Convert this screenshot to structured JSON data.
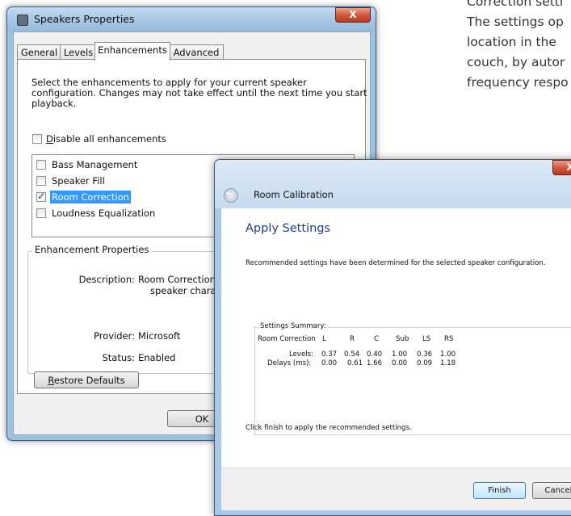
{
  "background_text": [
    "Correction setti",
    "The settings op",
    "location in the",
    "couch, by autor",
    "frequency respo"
  ],
  "speakers_window": {
    "title": "Speakers Properties",
    "close_label": "X",
    "tabs": [
      "General",
      "Levels",
      "Enhancements",
      "Advanced"
    ],
    "active_tab": "Enhancements",
    "description_lines": [
      "Select the enhancements to apply for your current speaker",
      "configuration. Changes may not take effect until the next time you start",
      "playback."
    ],
    "disable_all": {
      "prefix": "",
      "underlined": "D",
      "rest": "isable all enhancements",
      "checked": false
    },
    "enhancements": [
      {
        "label": "Bass Management",
        "checked": false,
        "selected": false
      },
      {
        "label": "Speaker Fill",
        "checked": false,
        "selected": false
      },
      {
        "label": "Room Correction",
        "checked": true,
        "selected": true
      },
      {
        "label": "Loudness Equalization",
        "checked": false,
        "selected": false
      }
    ],
    "properties_group_label": "Enhancement Properties",
    "description_key": "Description:",
    "description_value_line1": "Room Correction co",
    "description_value_line2": "speaker characteris",
    "provider_key": "Provider:",
    "provider_value": "Microsoft",
    "status_key": "Status:",
    "status_value": "Enabled",
    "restore_defaults": {
      "underlined": "R",
      "rest": "estore Defaults"
    },
    "ok_label": "OK"
  },
  "calibration_window": {
    "title": "Room Calibration",
    "close_label": "X",
    "heading": "Apply Settings",
    "intro": "Recommended settings have been determined for the selected speaker configuration.",
    "summary_label": "Settings Summary:",
    "table_header": [
      "Room Correction",
      "L",
      "R",
      "C",
      "Sub",
      "LS",
      "RS"
    ],
    "levels_label": "Levels:",
    "levels": [
      "0.37",
      "0.54",
      "0.40",
      "1.00",
      "0.36",
      "1.00"
    ],
    "delays_label": "Delays (ms):",
    "delays": [
      "0.00",
      "0.61",
      "1.66",
      "0.00",
      "0.09",
      "1.18"
    ],
    "finish_note": "Click finish to apply the recommended settings.",
    "finish_label": "Finish",
    "cancel_label": "Cancel"
  },
  "colors": {
    "selection": "#3399ff",
    "heading_blue": "#1e3f91",
    "close_red": "#c8452a"
  },
  "icons": [
    "speaker-app-icon",
    "close-icon",
    "back-arrow-icon",
    "checkmark-icon"
  ]
}
